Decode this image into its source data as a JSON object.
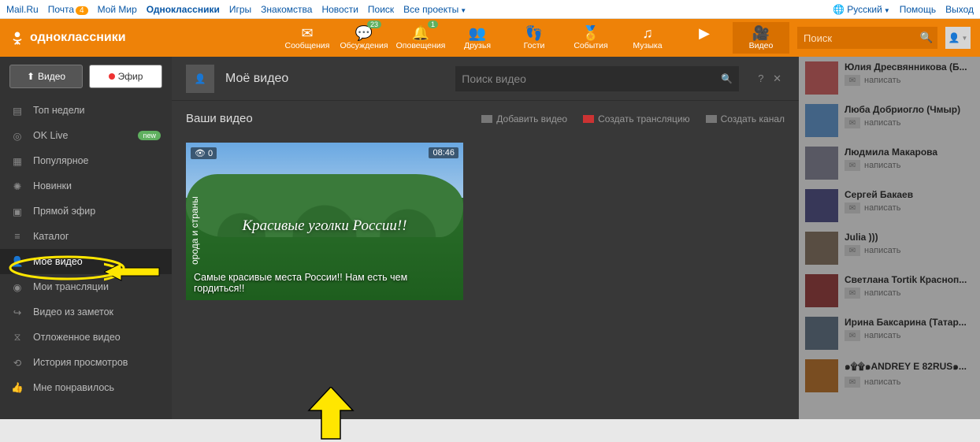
{
  "topbar": {
    "left": [
      "Mail.Ru",
      "Почта",
      "Мой Мир",
      "Одноклассники",
      "Игры",
      "Знакомства",
      "Новости",
      "Поиск",
      "Все проекты"
    ],
    "mail_badge": "4",
    "right": {
      "lang": "Русский",
      "help": "Помощь",
      "exit": "Выход"
    }
  },
  "header": {
    "brand": "одноклассники",
    "nav": [
      {
        "label": "Сообщения",
        "badge": ""
      },
      {
        "label": "Обсуждения",
        "badge": "23"
      },
      {
        "label": "Оповещения",
        "badge": "1"
      },
      {
        "label": "Друзья",
        "badge": ""
      },
      {
        "label": "Гости",
        "badge": ""
      },
      {
        "label": "События",
        "badge": ""
      },
      {
        "label": "Музыка",
        "badge": ""
      },
      {
        "label": "",
        "badge": ""
      },
      {
        "label": "Видео",
        "badge": ""
      }
    ],
    "search_placeholder": "Поиск"
  },
  "sidebar": {
    "upload": "Видео",
    "live": "Эфир",
    "items": [
      {
        "label": "Топ недели"
      },
      {
        "label": "OK Live",
        "new": "new"
      },
      {
        "label": "Популярное"
      },
      {
        "label": "Новинки"
      },
      {
        "label": "Прямой эфир"
      },
      {
        "label": "Каталог"
      },
      {
        "label": "Моё видео"
      },
      {
        "label": "Мои трансляции"
      },
      {
        "label": "Видео из заметок"
      },
      {
        "label": "Отложенное видео"
      },
      {
        "label": "История просмотров"
      },
      {
        "label": "Мне понравилось"
      }
    ]
  },
  "panel": {
    "title": "Моё видео",
    "search_placeholder": "Поиск видео",
    "help": "? ✕",
    "sub_title": "Ваши видео",
    "add": "Добавить видео",
    "stream": "Создать трансляцию",
    "channel": "Создать канал"
  },
  "thumb": {
    "views": "👁 0",
    "time": "08:46",
    "side": "орода и страны",
    "overlay": "Красивые уголки России!!",
    "caption": "Самые красивые места России!! Нам есть чем гордиться!!"
  },
  "friends": [
    {
      "name": "Юлия Дресвянникова (Б...",
      "write": "написать"
    },
    {
      "name": "Люба Добриогло (Чмыр)",
      "write": "написать"
    },
    {
      "name": "Людмила Макарова",
      "write": "написать"
    },
    {
      "name": "Сергей Бакаев",
      "write": "написать"
    },
    {
      "name": "Julia )))",
      "write": "написать"
    },
    {
      "name": "Светлана Tortik Красноп...",
      "write": "написать"
    },
    {
      "name": "Ирина Баксарина (Татар...",
      "write": "написать"
    },
    {
      "name": "๑۩۩๑ANDREY E 82RUS๑...",
      "write": "написать"
    }
  ]
}
